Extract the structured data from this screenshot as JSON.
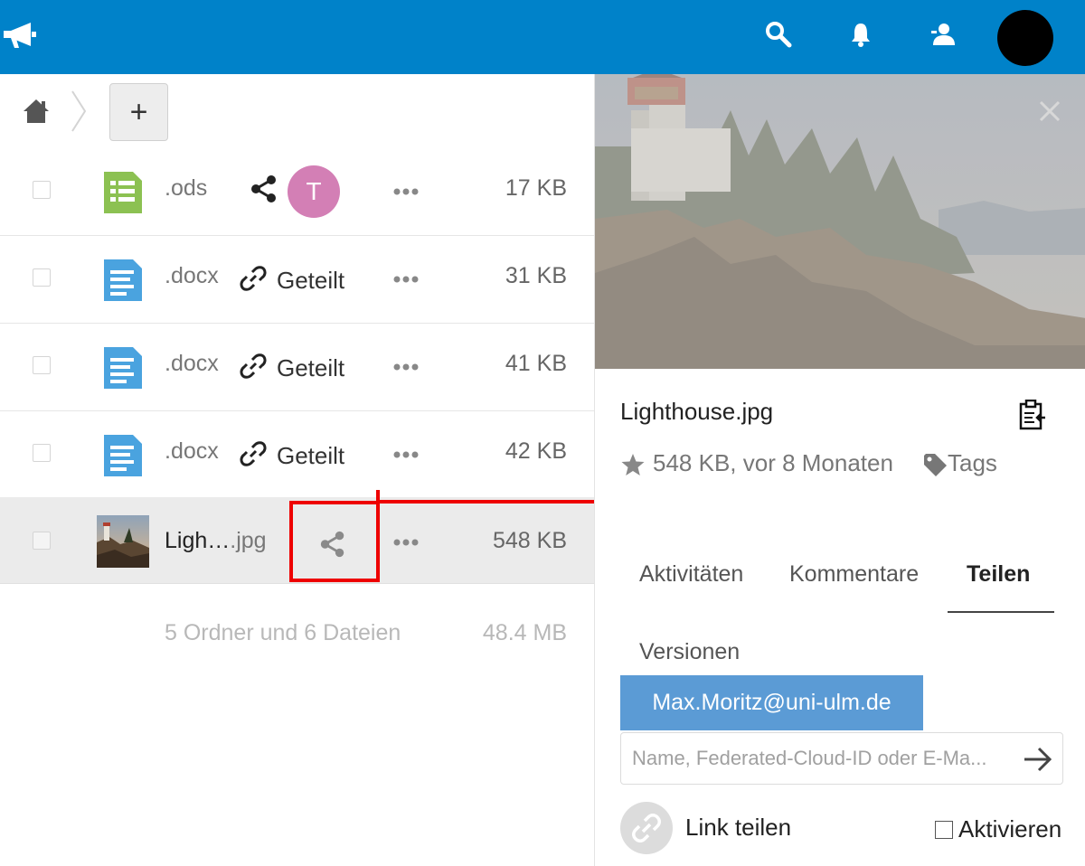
{
  "colors": {
    "header": "#0082c9",
    "accent_chip": "#5b9bd5",
    "avatar_user": "#d37fb5",
    "highlight": "#ee0000"
  },
  "header": {
    "logo_icon": "megaphone-logo-icon",
    "icons": [
      "search-icon",
      "bell-icon",
      "contacts-icon"
    ]
  },
  "breadcrumb": {
    "home_icon": "home-icon",
    "new_label": "+"
  },
  "files": [
    {
      "name": ".ods",
      "icon": "spreadsheet-icon",
      "share": "share-icon",
      "shared_with_initial": "T",
      "size": "17 KB"
    },
    {
      "name": ".docx",
      "icon": "document-icon",
      "share": "link-icon",
      "share_label": "Geteilt",
      "size": "31 KB"
    },
    {
      "name": ".docx",
      "icon": "document-icon",
      "share": "link-icon",
      "share_label": "Geteilt",
      "size": "41 KB"
    },
    {
      "name": ".docx",
      "icon": "document-icon",
      "share": "link-icon",
      "share_label": "Geteilt",
      "size": "42 KB"
    },
    {
      "name_base": "Ligh…",
      "name_ext": ".jpg",
      "icon": "image-thumbnail",
      "share": "share-icon",
      "size": "548 KB"
    }
  ],
  "summary": {
    "text": "5 Ordner und 6 Dateien",
    "size": "48.4 MB"
  },
  "sidebar": {
    "file_name": "Lighthouse.jpg",
    "meta": "548 KB, vor 8 Monaten",
    "tags_label": "Tags",
    "tabs": [
      {
        "label": "Aktivitäten",
        "active": false
      },
      {
        "label": "Kommentare",
        "active": false
      },
      {
        "label": "Teilen",
        "active": true
      },
      {
        "label": "Versionen",
        "active": false
      }
    ],
    "share_chip": "Max.Moritz@uni-ulm.de",
    "share_placeholder": "Name, Federated-Cloud-ID oder E-Ma...",
    "link_share_label": "Link teilen",
    "activate_label": "Aktivieren"
  }
}
